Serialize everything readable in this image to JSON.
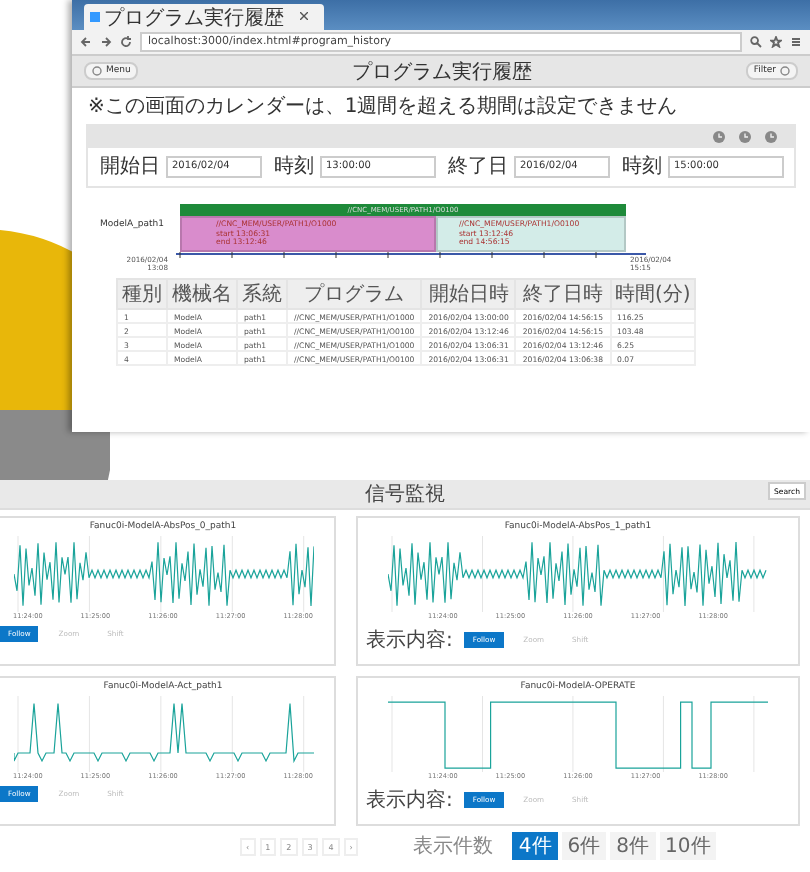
{
  "browser": {
    "tab_title": "プログラム実行履歴",
    "url": "localhost:3000/index.html#program_history",
    "header": {
      "menu_button": "Menu",
      "title": "プログラム実行履歴",
      "filter_button": "Filter"
    },
    "notice": "※この画面のカレンダーは、1週間を超える期間は設定できません",
    "form": [
      {
        "label": "開始日",
        "value": "2016/02/04"
      },
      {
        "label": "時刻",
        "value": "13:00:00"
      },
      {
        "label": "終了日",
        "value": "2016/02/04"
      },
      {
        "label": "時刻",
        "value": "15:00:00"
      }
    ],
    "timeline": {
      "row_label": "ModelA_path1",
      "top_bar": "//CNC_MEM/USER/PATH1/O0100",
      "segments": [
        {
          "lines": [
            "//CNC_MEM/USER/PATH1/O1000",
            "start 13:06:31",
            "end 13:12:46"
          ],
          "color": "#d98ccc"
        },
        {
          "lines": [
            "//CNC_MEM/USER/PATH1/O0100",
            "start 13:12:46",
            "end 14:56:15"
          ],
          "color": "#d3ece8"
        }
      ],
      "axis_start": "2016/02/04 13:08",
      "axis_end": "2016/02/04 15:15"
    },
    "table": {
      "columns": [
        "種別",
        "機械名",
        "系統",
        "プログラム",
        "開始日時",
        "終了日時",
        "時間(分)"
      ],
      "rows": [
        [
          "1",
          "ModelA",
          "path1",
          "//CNC_MEM/USER/PATH1/O1000",
          "2016/02/04 13:00:00",
          "2016/02/04 14:56:15",
          "116.25"
        ],
        [
          "2",
          "ModelA",
          "path1",
          "//CNC_MEM/USER/PATH1/O0100",
          "2016/02/04 13:12:46",
          "2016/02/04 14:56:15",
          "103.48"
        ],
        [
          "3",
          "ModelA",
          "path1",
          "//CNC_MEM/USER/PATH1/O1000",
          "2016/02/04 13:06:31",
          "2016/02/04 13:12:46",
          "6.25"
        ],
        [
          "4",
          "ModelA",
          "path1",
          "//CNC_MEM/USER/PATH1/O0100",
          "2016/02/04 13:06:31",
          "2016/02/04 13:06:38",
          "0.07"
        ]
      ]
    }
  },
  "monitor": {
    "title": "信号監視",
    "search_button": "Search",
    "panels": [
      {
        "title": "Fanuc0i-ModelA-AbsPos_0_path1",
        "kind": "wave",
        "x_ticks": [
          "11:24:00",
          "11:25:00",
          "11:26:00",
          "11:27:00",
          "11:28:00"
        ],
        "buttons": [
          {
            "label": "Follow",
            "selected": true
          },
          {
            "label": "Zoom",
            "selected": false
          },
          {
            "label": "Shift",
            "selected": false
          }
        ]
      },
      {
        "title": "Fanuc0i-ModelA-AbsPos_1_path1",
        "kind": "wave",
        "display_label": "表示内容:",
        "x_ticks": [
          "11:24:00",
          "11:25:00",
          "11:26:00",
          "11:27:00",
          "11:28:00"
        ],
        "buttons": [
          {
            "label": "Follow",
            "selected": true
          },
          {
            "label": "Zoom",
            "selected": false
          },
          {
            "label": "Shift",
            "selected": false
          }
        ]
      },
      {
        "title": "Fanuc0i-ModelA-Act_path1",
        "kind": "spike",
        "x_ticks": [
          "11:24:00",
          "11:25:00",
          "11:26:00",
          "11:27:00",
          "11:28:00"
        ],
        "buttons": [
          {
            "label": "Follow",
            "selected": true
          },
          {
            "label": "Zoom",
            "selected": false
          },
          {
            "label": "Shift",
            "selected": false
          }
        ]
      },
      {
        "title": "Fanuc0i-ModelA-OPERATE",
        "kind": "step",
        "display_label": "表示内容:",
        "x_ticks": [
          "11:24:00",
          "11:25:00",
          "11:26:00",
          "11:27:00",
          "11:28:00"
        ],
        "buttons": [
          {
            "label": "Follow",
            "selected": true
          },
          {
            "label": "Zoom",
            "selected": false
          },
          {
            "label": "Shift",
            "selected": false
          }
        ]
      }
    ],
    "pagination": [
      "‹",
      "1",
      "2",
      "3",
      "4",
      "›"
    ],
    "page_size_label": "表示件数",
    "page_sizes": [
      {
        "label": "4件",
        "selected": true
      },
      {
        "label": "6件",
        "selected": false
      },
      {
        "label": "8件",
        "selected": false
      },
      {
        "label": "10件",
        "selected": false
      }
    ]
  }
}
